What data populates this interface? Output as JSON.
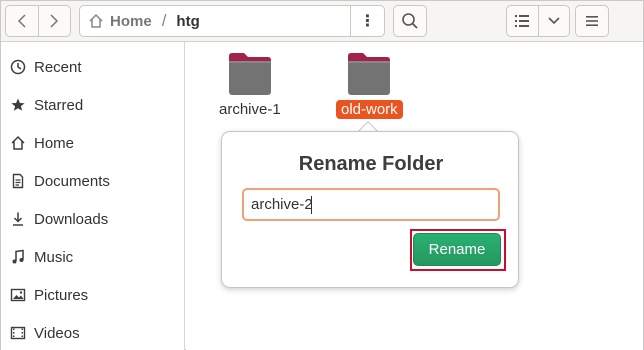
{
  "header": {
    "path": {
      "home_label": "Home",
      "separator": "/",
      "current": "htg",
      "menu_glyph": "⋮"
    },
    "icons": {
      "back": "chevron-left-icon",
      "forward": "chevron-right-icon",
      "home": "home-icon",
      "search": "search-icon",
      "list_view": "list-view-icon",
      "view_options": "chevron-down-icon",
      "main_menu": "hamburger-menu-icon"
    }
  },
  "sidebar": {
    "items": [
      {
        "label": "Recent",
        "icon": "clock-icon"
      },
      {
        "label": "Starred",
        "icon": "star-icon"
      },
      {
        "label": "Home",
        "icon": "home-icon"
      },
      {
        "label": "Documents",
        "icon": "document-icon"
      },
      {
        "label": "Downloads",
        "icon": "download-icon"
      },
      {
        "label": "Music",
        "icon": "music-note-icon"
      },
      {
        "label": "Pictures",
        "icon": "picture-icon"
      },
      {
        "label": "Videos",
        "icon": "video-icon"
      }
    ]
  },
  "content": {
    "folders": [
      {
        "name": "archive-1",
        "selected": false
      },
      {
        "name": "old-work",
        "selected": true
      }
    ]
  },
  "rename_dialog": {
    "title": "Rename Folder",
    "input_value": "archive-2",
    "confirm_label": "Rename"
  },
  "colors": {
    "accent_orange": "#e95420",
    "folder_tab": "#a3224a",
    "folder_body": "#737373",
    "confirm_green": "#26a269",
    "highlight_red": "#c8102e",
    "input_focus": "#f0a177"
  }
}
